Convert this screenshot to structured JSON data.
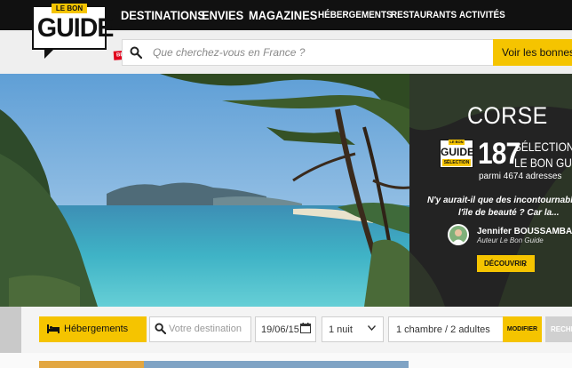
{
  "header": {
    "logo": {
      "tab": "LE BON",
      "word": "GUIDE",
      "beta": "BETA"
    },
    "nav": [
      {
        "label": "DESTINATIONS"
      },
      {
        "label": "ENVIES"
      },
      {
        "label": "MAGAZINES"
      },
      {
        "label": "HÉBERGEMENTS"
      },
      {
        "label": "RESTAURANTS"
      },
      {
        "label": "ACTIVITÉS"
      }
    ]
  },
  "search": {
    "placeholder": "Que cherchez-vous en France ?",
    "button_label": "Voir les bonnes adr"
  },
  "feature": {
    "destination": "CORSE",
    "badge": {
      "tab": "LE BON",
      "word": "GUIDE",
      "selection": "SÉLECTION"
    },
    "count": "187",
    "selections_line1": "SÉLECTIONS",
    "selections_line2": "LE BON GUIDE",
    "addresses": "parmi 4674 adresses",
    "quote_line1": "N'y aurait-il que des incontournables",
    "quote_line2": "l'île de beauté ? Car la...",
    "author_name": "Jennifer BOUSSAMBA",
    "author_role": "Auteur Le Bon Guide",
    "discover_label": "DÉCOUVRIR",
    "discover_chevron": "›"
  },
  "booking": {
    "category_label": "Hébergements",
    "destination_placeholder": "Votre destination",
    "date": "19/06/15",
    "nights": "1 nuit",
    "rooms": "1 chambre / 2 adultes",
    "modify_label": "MODIFIER",
    "search_label": "RECHE"
  },
  "colors": {
    "accent": "#f5c400",
    "header_bg": "#111111",
    "panel_bg": "#232323"
  },
  "icons": [
    "search-icon",
    "bed-icon",
    "calendar-icon",
    "chevron-down-icon",
    "chevron-right-icon"
  ]
}
